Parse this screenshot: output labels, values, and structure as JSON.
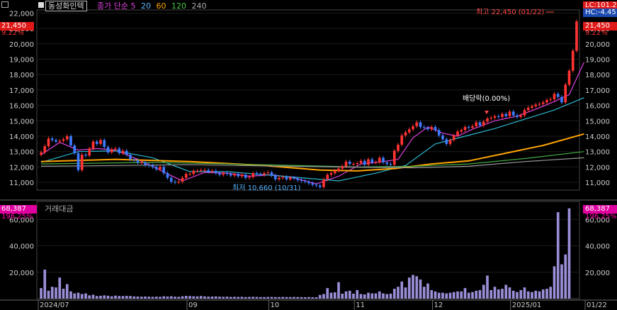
{
  "header": {
    "stock_name": "동성화인텍",
    "ma_title": "종가 단순",
    "ma_periods": [
      {
        "label": "5",
        "color": "#e040e0"
      },
      {
        "label": "20",
        "color": "#5ab4ff"
      },
      {
        "label": "60",
        "color": "#ffa500"
      },
      {
        "label": "120",
        "color": "#44cc44"
      },
      {
        "label": "240",
        "color": "#aaaaaa"
      }
    ],
    "volume_title": "거래대금"
  },
  "price_panel": {
    "left_price_tag": "21,450",
    "left_change_tag": "9.22%",
    "right_lc": "LC:101.22",
    "right_hc": "HC:-4.45",
    "right_price_tag": "21,450",
    "right_change_tag": "9.22%",
    "annotation_high": "최고 22,450 (01/22)",
    "annotation_low": "최저 10,660 (10/31)",
    "annotation_dividend": "배당락(0.00%)",
    "colors": {
      "up": "#ff3333",
      "down": "#3d7bff",
      "tag": "#ff2020",
      "volume_bar": "#9b8ed8",
      "volume_tag": "#ff00aa"
    }
  },
  "volume_panel": {
    "left_value_tag": "68,387",
    "left_pct_tag": "196.25%",
    "right_value_tag": "68,387",
    "right_pct_tag": "196.25%"
  },
  "chart_data": {
    "type": "candlestick",
    "price_axis": {
      "min": 10500,
      "max": 22200,
      "ticks": [
        "22,000",
        "21,000",
        "20,000",
        "19,000",
        "18,000",
        "17,000",
        "16,000",
        "15,000",
        "14,000",
        "13,000",
        "12,000",
        "11,000"
      ],
      "tick_values": [
        22000,
        21000,
        20000,
        19000,
        18000,
        17000,
        16000,
        15000,
        14000,
        13000,
        12000,
        11000
      ]
    },
    "volume_axis": {
      "max": 72000,
      "ticks": [
        "60,000",
        "40,000",
        "20,000"
      ],
      "tick_values": [
        60000,
        40000,
        20000
      ]
    },
    "x_axis_labels": [
      {
        "label": "2024/07",
        "index": 0
      },
      {
        "label": "09",
        "index": 40
      },
      {
        "label": "10",
        "index": 62
      },
      {
        "label": "11",
        "index": 85
      },
      {
        "label": "12",
        "index": 106
      },
      {
        "label": "2025/01",
        "index": 127
      },
      {
        "label": "01/22",
        "index": 145
      }
    ],
    "closes": [
      12950,
      13350,
      13850,
      13750,
      13650,
      13700,
      13800,
      14000,
      13400,
      12900,
      11800,
      12800,
      12750,
      13200,
      13650,
      13500,
      13750,
      13300,
      12950,
      13150,
      13200,
      12900,
      13050,
      12800,
      12500,
      12450,
      12300,
      12300,
      12150,
      12100,
      12000,
      11850,
      12000,
      11600,
      11300,
      11050,
      11000,
      11050,
      11300,
      11550,
      11550,
      11750,
      11750,
      11800,
      11800,
      11700,
      11750,
      11600,
      11500,
      11600,
      11550,
      11450,
      11550,
      11400,
      11500,
      11300,
      11350,
      11600,
      11550,
      11500,
      11600,
      11650,
      11450,
      11200,
      11300,
      11350,
      11200,
      11300,
      11250,
      11150,
      11100,
      11050,
      10950,
      10850,
      10800,
      10700,
      11200,
      11500,
      11600,
      11750,
      11900,
      12050,
      12350,
      12200,
      12200,
      12250,
      12400,
      12150,
      12500,
      12300,
      12300,
      12600,
      12300,
      12200,
      12150,
      13050,
      13450,
      14050,
      14250,
      14450,
      14650,
      14900,
      14600,
      14550,
      14450,
      14600,
      14400,
      14050,
      13800,
      13500,
      13750,
      14050,
      14300,
      14400,
      14600,
      14550,
      14650,
      14900,
      14700,
      14950,
      15150,
      15200,
      15300,
      15250,
      15450,
      15300,
      15600,
      15350,
      15250,
      15350,
      15700,
      15850,
      15950,
      16050,
      16100,
      16200,
      16350,
      16400,
      16750,
      16550,
      16200,
      17350,
      18250,
      19550,
      21450
    ],
    "volumes": [
      8000,
      22000,
      6000,
      9000,
      8500,
      16000,
      7500,
      11000,
      5500,
      4000,
      4500,
      3500,
      4000,
      2500,
      3000,
      2000,
      2200,
      2500,
      2200,
      1800,
      2300,
      2000,
      2000,
      2100,
      2000,
      1700,
      1600,
      1500,
      1600,
      1500,
      1400,
      1500,
      1400,
      1800,
      1600,
      1800,
      1500,
      1400,
      1800,
      2100,
      2000,
      1800,
      1700,
      2000,
      1700,
      1500,
      1600,
      1700,
      1500,
      1400,
      1500,
      1300,
      1400,
      1300,
      1400,
      1200,
      1300,
      1400,
      1300,
      1200,
      1200,
      1300,
      1300,
      1200,
      1200,
      1300,
      1200,
      1200,
      1300,
      1200,
      1200,
      1100,
      1200,
      1100,
      1100,
      2800,
      3500,
      8000,
      4500,
      4800,
      12500,
      3800,
      5500,
      6000,
      3800,
      6500,
      3500,
      3200,
      4500,
      4000,
      4000,
      5500,
      4000,
      3500,
      3800,
      7500,
      9000,
      13000,
      8500,
      16000,
      18000,
      17000,
      14500,
      9000,
      11500,
      6500,
      5500,
      4500,
      4500,
      4000,
      4500,
      5000,
      5500,
      5500,
      8000,
      4500,
      5000,
      6000,
      6500,
      10500,
      17500,
      6500,
      9000,
      7000,
      7500,
      10500,
      8500,
      6000,
      5000,
      6500,
      8500,
      5500,
      5000,
      6000,
      5500,
      7000,
      7500,
      9000,
      24500,
      65500,
      26000,
      33500,
      68387
    ],
    "ma_lines": {
      "ma5": [
        [
          0,
          12800
        ],
        [
          5,
          13600
        ],
        [
          10,
          13100
        ],
        [
          15,
          13200
        ],
        [
          20,
          13100
        ],
        [
          25,
          12600
        ],
        [
          30,
          12050
        ],
        [
          34,
          11550
        ],
        [
          38,
          11100
        ],
        [
          44,
          11650
        ],
        [
          50,
          11600
        ],
        [
          56,
          11400
        ],
        [
          62,
          11500
        ],
        [
          68,
          11300
        ],
        [
          74,
          10900
        ],
        [
          80,
          11400
        ],
        [
          86,
          12200
        ],
        [
          92,
          12350
        ],
        [
          96,
          12500
        ],
        [
          100,
          13900
        ],
        [
          104,
          14600
        ],
        [
          108,
          14200
        ],
        [
          112,
          14000
        ],
        [
          116,
          14450
        ],
        [
          122,
          15000
        ],
        [
          128,
          15300
        ],
        [
          134,
          15850
        ],
        [
          138,
          16250
        ],
        [
          142,
          16700
        ],
        [
          146,
          18800
        ]
      ],
      "ma20": [
        [
          0,
          12300
        ],
        [
          10,
          13000
        ],
        [
          20,
          13050
        ],
        [
          30,
          12600
        ],
        [
          40,
          11700
        ],
        [
          50,
          11700
        ],
        [
          60,
          11500
        ],
        [
          70,
          11300
        ],
        [
          80,
          11100
        ],
        [
          90,
          11600
        ],
        [
          98,
          12100
        ],
        [
          106,
          13500
        ],
        [
          114,
          14000
        ],
        [
          122,
          14500
        ],
        [
          130,
          15100
        ],
        [
          138,
          15700
        ],
        [
          146,
          16500
        ]
      ],
      "ma60": [
        [
          0,
          12350
        ],
        [
          20,
          12500
        ],
        [
          40,
          12350
        ],
        [
          60,
          12100
        ],
        [
          75,
          11800
        ],
        [
          85,
          11750
        ],
        [
          95,
          11900
        ],
        [
          105,
          12200
        ],
        [
          115,
          12400
        ],
        [
          125,
          12900
        ],
        [
          135,
          13400
        ],
        [
          146,
          14150
        ]
      ],
      "ma120": [
        [
          0,
          12200
        ],
        [
          30,
          12300
        ],
        [
          60,
          12150
        ],
        [
          85,
          12000
        ],
        [
          100,
          12050
        ],
        [
          115,
          12200
        ],
        [
          130,
          12550
        ],
        [
          146,
          13000
        ]
      ],
      "ma240": [
        [
          0,
          12050
        ],
        [
          40,
          12150
        ],
        [
          80,
          12000
        ],
        [
          100,
          11950
        ],
        [
          115,
          12050
        ],
        [
          130,
          12350
        ],
        [
          146,
          12600
        ]
      ]
    }
  }
}
